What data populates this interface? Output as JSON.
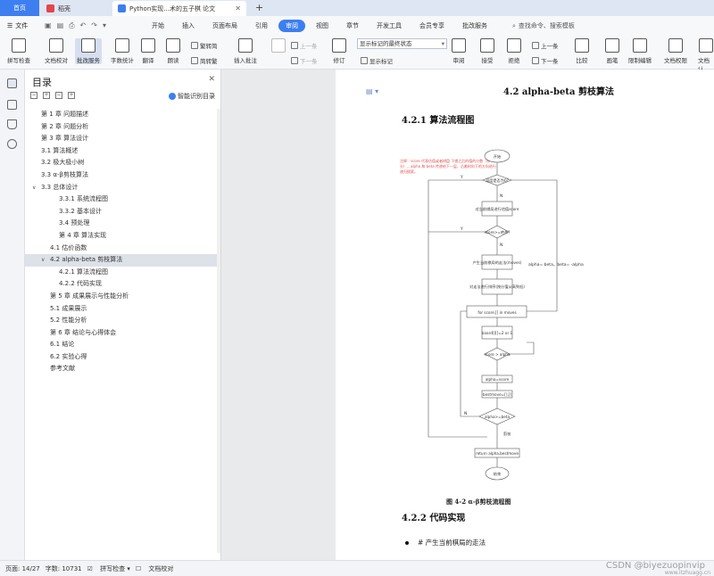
{
  "tabs": {
    "home": "首页",
    "t2": "稻壳",
    "t3": "Python实现...术的五子棋 论文"
  },
  "menubar": {
    "file": "文件",
    "items": [
      "开始",
      "插入",
      "页面布局",
      "引用",
      "审阅",
      "视图",
      "章节",
      "开发工具",
      "会员专享",
      "批改服务"
    ],
    "active_index": 4,
    "search": "查找命令、搜索模板"
  },
  "ribbon": {
    "spell": "拼写检查",
    "proof": "文档校对",
    "batch": "批改服务",
    "wordcount": "字数统计",
    "translate": "翻译",
    "read": "朗读",
    "trad": "繁转简",
    "simp": "简转繁",
    "insert_comment": "插入批注",
    "prev": "上一条",
    "next": "下一条",
    "track": "修订",
    "show_dropdown": "显示标记的最终状态",
    "show_marks": "显示标记",
    "prev2": "上一条",
    "next2": "下一条",
    "review": "审阅",
    "accept": "接受",
    "reject": "拒绝",
    "compare": "比较",
    "ink": "画笔",
    "restrict": "限制编辑",
    "doc_perm": "文档权限",
    "doc_auth": "文档认"
  },
  "toc": {
    "title": "目录",
    "smart": "智能识别目录",
    "items": [
      {
        "text": "第 1 章  问题描述",
        "indent": 18
      },
      {
        "text": "第 2 章  问题分析",
        "indent": 18
      },
      {
        "text": "第 3 章  算法设计",
        "indent": 18
      },
      {
        "text": "3.1  算法概述",
        "indent": 18
      },
      {
        "text": "3.2  极大极小树",
        "indent": 18
      },
      {
        "text": "3.3 α-β剪枝算法",
        "indent": 18
      },
      {
        "text": "3.3 总体设计",
        "indent": 18,
        "arrow": true
      },
      {
        "text": "3.3.1  系统流程图",
        "indent": 38
      },
      {
        "text": "3.3.2  基本设计",
        "indent": 38
      },
      {
        "text": "3.4  预处理",
        "indent": 38
      },
      {
        "text": "第 4 章  算法实现",
        "indent": 38
      },
      {
        "text": "4.1  估价函数",
        "indent": 28
      },
      {
        "text": "4.2 alpha-beta 剪枝算法",
        "indent": 28,
        "arrow": true,
        "selected": true
      },
      {
        "text": "4.2.1  算法流程图",
        "indent": 38
      },
      {
        "text": "4.2.2  代码实现",
        "indent": 38
      },
      {
        "text": "第 5 章  成果展示与性能分析",
        "indent": 28
      },
      {
        "text": "5.1  成果展示",
        "indent": 28
      },
      {
        "text": "5.2  性能分析",
        "indent": 28
      },
      {
        "text": "第 6 章  结论与心得体会",
        "indent": 28
      },
      {
        "text": "6.1  结论",
        "indent": 28
      },
      {
        "text": "6.2  实验心得",
        "indent": 28
      },
      {
        "text": "参考文献",
        "indent": 28
      }
    ]
  },
  "doc": {
    "heading": "4.2 alpha-beta 剪枝算法",
    "sub1": "4.2.1  算法流程图",
    "caption": "图 4-2 α-β剪枝流程图",
    "sub2": "4.2.2  代码实现",
    "bullet": "# 产生当前棋局的走法",
    "note": "注释：score 代表估值或者棋盘 下棋之后的值的分数（积分），alpha 和 beta 传递给下一层，沿着树向下的方向进行递归搜索。",
    "flow": {
      "start": "开始",
      "depth": "深度是否为0?",
      "eval": "对当前棋局进行估值score",
      "check": "score>=绝杀?",
      "gen": "产生当前棋局的走法(moves)",
      "order": "对走法进行排序(按分值从高到低)",
      "loop": "for score,[] in moves",
      "minimax": "board[][]=2\nor 1",
      "cmp1": "score > alpha",
      "assign": "alpha=score",
      "best": "bestmove=[],[]",
      "cmp2": "alpha>=beta",
      "prune": "剪枝",
      "ret": "return alpha,bestmove",
      "end": "结束",
      "side": "alpha= beta，beta= -alpha",
      "n": "N",
      "y": "Y"
    }
  },
  "status": {
    "page": "页面: 14/27",
    "words": "字数: 10731",
    "spell": "拼写检查",
    "proof": "文档校对"
  },
  "watermark": "CSDN @biyezuopinvip",
  "watermark2": "www.itzhuagg.cn"
}
